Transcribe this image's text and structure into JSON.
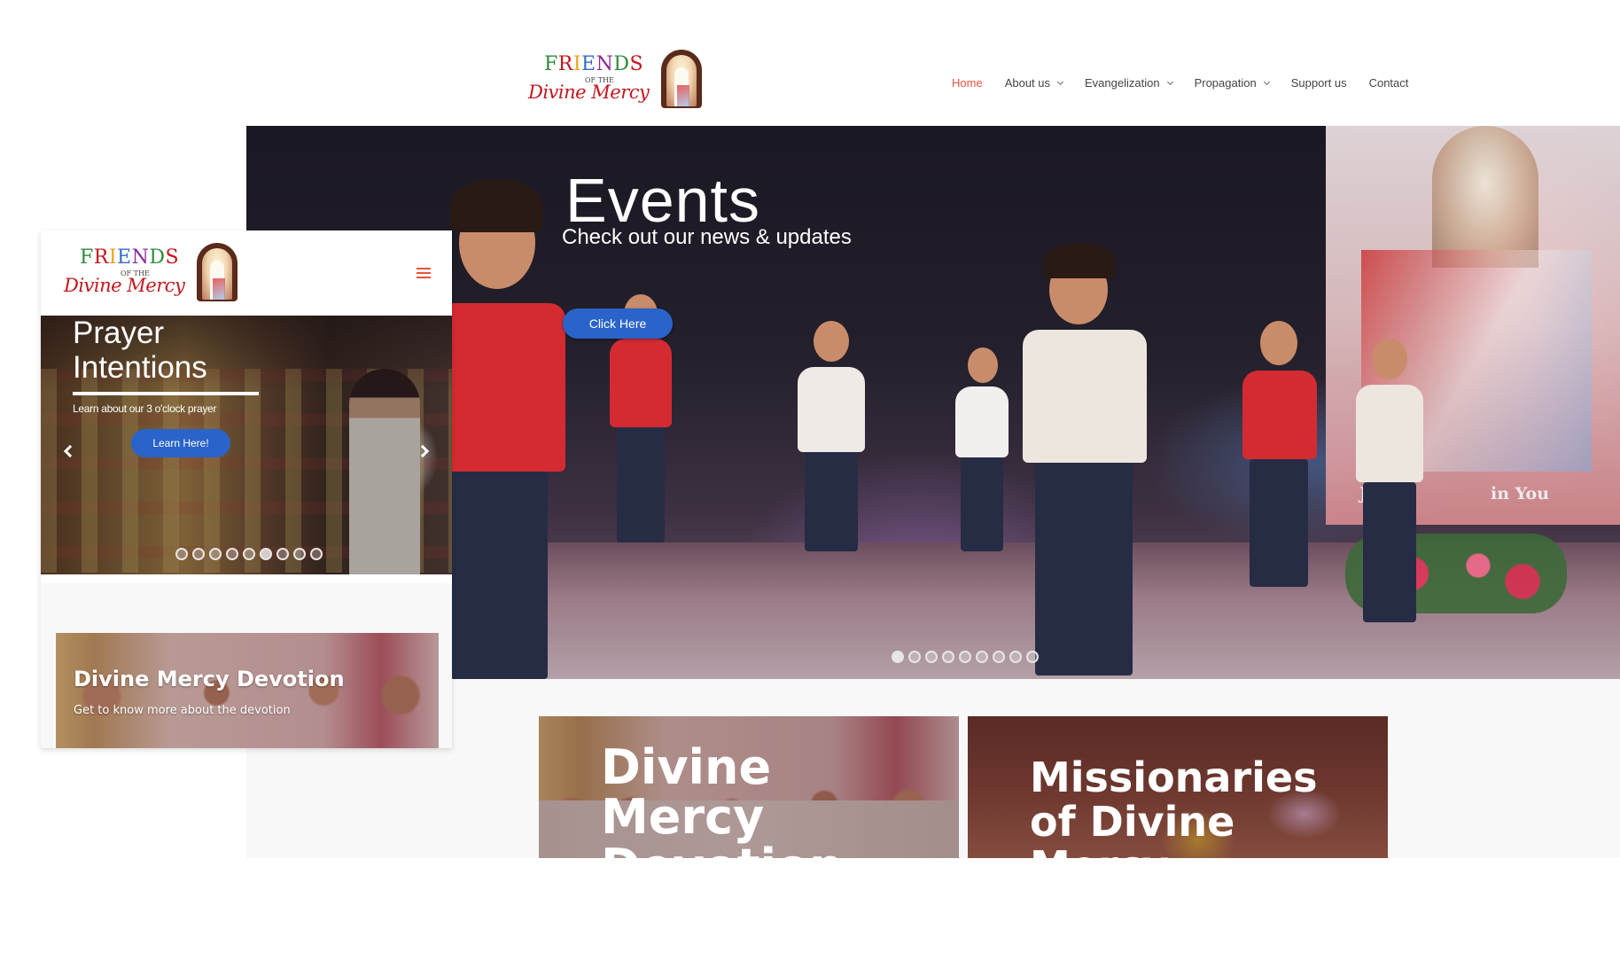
{
  "brand": {
    "logo_line1": "FRIENDS",
    "logo_line2": "OF THE",
    "logo_line3": "Divine Mercy",
    "logo_letter_colors": [
      "#2e8b3a",
      "#c4161c",
      "#f0a21a",
      "#3a6bc4",
      "#8a2a9a",
      "#2e8b3a",
      "#c4161c"
    ]
  },
  "nav": {
    "items": [
      {
        "label": "Home",
        "active": true,
        "has_dropdown": false
      },
      {
        "label": "About us",
        "active": false,
        "has_dropdown": true
      },
      {
        "label": "Evangelization",
        "active": false,
        "has_dropdown": true
      },
      {
        "label": "Propagation",
        "active": false,
        "has_dropdown": true
      },
      {
        "label": "Support us",
        "active": false,
        "has_dropdown": false
      },
      {
        "label": "Contact",
        "active": false,
        "has_dropdown": false
      }
    ]
  },
  "hero": {
    "title": "Events",
    "subtitle": "Check out our news & updates",
    "button_label": "Click Here",
    "banner_text_left": "Je",
    "banner_text_right": "in You",
    "slide_count": 9,
    "active_slide": 1
  },
  "cards": [
    {
      "title": "Divine Mercy Devotion"
    },
    {
      "title": "Missionaries of Divine Mercy"
    }
  ],
  "mobile": {
    "slider_title": "Prayer Intentions",
    "slider_sub": "Learn about our 3 o'clock prayer",
    "button_label": "Learn Here!",
    "slide_count": 9,
    "active_slide": 6,
    "card_title": "Divine Mercy Devotion",
    "card_sub": "Get to know more about the devotion"
  },
  "colors": {
    "accent": "#e8513a",
    "button_blue": "#2a63c9",
    "logo_red": "#c4161c"
  }
}
